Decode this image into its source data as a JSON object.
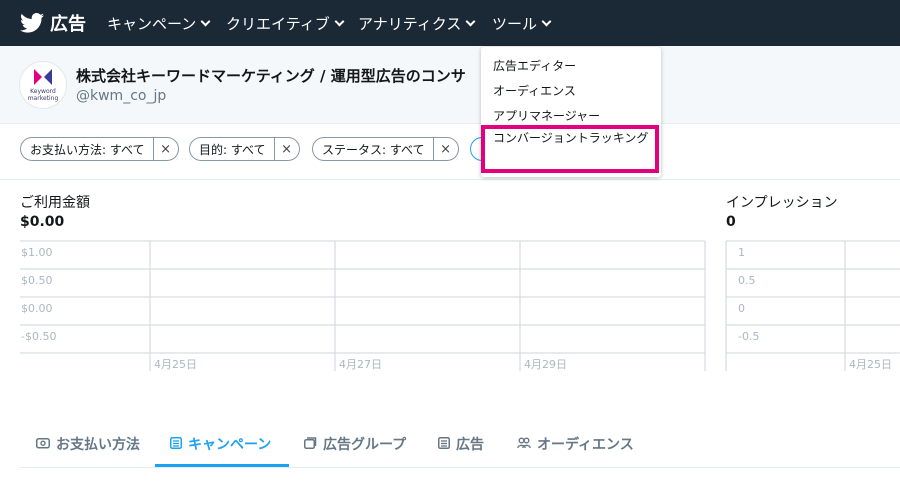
{
  "nav": {
    "brand": "広告",
    "items": [
      {
        "label": "キャンペーン"
      },
      {
        "label": "クリエイティブ"
      },
      {
        "label": "アナリティクス"
      },
      {
        "label": "ツール"
      }
    ]
  },
  "account": {
    "name": "株式会社キーワードマーケティング / 運用型広告のコンサ",
    "extra": "運用",
    "handle": "@kwm_co_jp",
    "logo_line1": "Keyword",
    "logo_line2": "marketing"
  },
  "filters": [
    {
      "label": "お支払い方法: すべて",
      "remove": "×"
    },
    {
      "label": "目的: すべて",
      "remove": "×"
    },
    {
      "label": "ステータス: すべて",
      "remove": "×"
    }
  ],
  "metrics": {
    "spend": {
      "title": "ご利用金額",
      "value": "$0.00"
    },
    "impressions": {
      "title": "インプレッション",
      "value": "0"
    }
  },
  "chart_data": [
    {
      "type": "line",
      "title": "ご利用金額",
      "y_ticks": [
        "$1.00",
        "$0.50",
        "$0.00",
        "-$0.50"
      ],
      "x_ticks": [
        "4月25日",
        "4月27日",
        "4月29日"
      ],
      "ylim": [
        -0.5,
        1.0
      ],
      "series": [],
      "grid": true
    },
    {
      "type": "line",
      "title": "インプレッション",
      "y_ticks": [
        "1",
        "0.5",
        "0",
        "-0.5"
      ],
      "x_ticks": [
        "4月25日"
      ],
      "ylim": [
        -0.5,
        1
      ],
      "series": [],
      "grid": true
    }
  ],
  "dropdown": {
    "items": [
      {
        "label": "広告エディター"
      },
      {
        "label": "オーディエンス"
      },
      {
        "label": "アプリマネージャー"
      },
      {
        "label": "コンバージョントラッキング"
      }
    ],
    "highlight_color": "#e3007e"
  },
  "tabs": [
    {
      "label": "お支払い方法",
      "icon": "credit-card-icon"
    },
    {
      "label": "キャンペーン",
      "icon": "campaign-icon",
      "active": true
    },
    {
      "label": "広告グループ",
      "icon": "ad-group-icon"
    },
    {
      "label": "広告",
      "icon": "ad-icon"
    },
    {
      "label": "オーディエンス",
      "icon": "audience-icon"
    }
  ],
  "colors": {
    "nav_bg": "#1b2836",
    "accent": "#1da1f2",
    "highlight": "#e3007e"
  }
}
